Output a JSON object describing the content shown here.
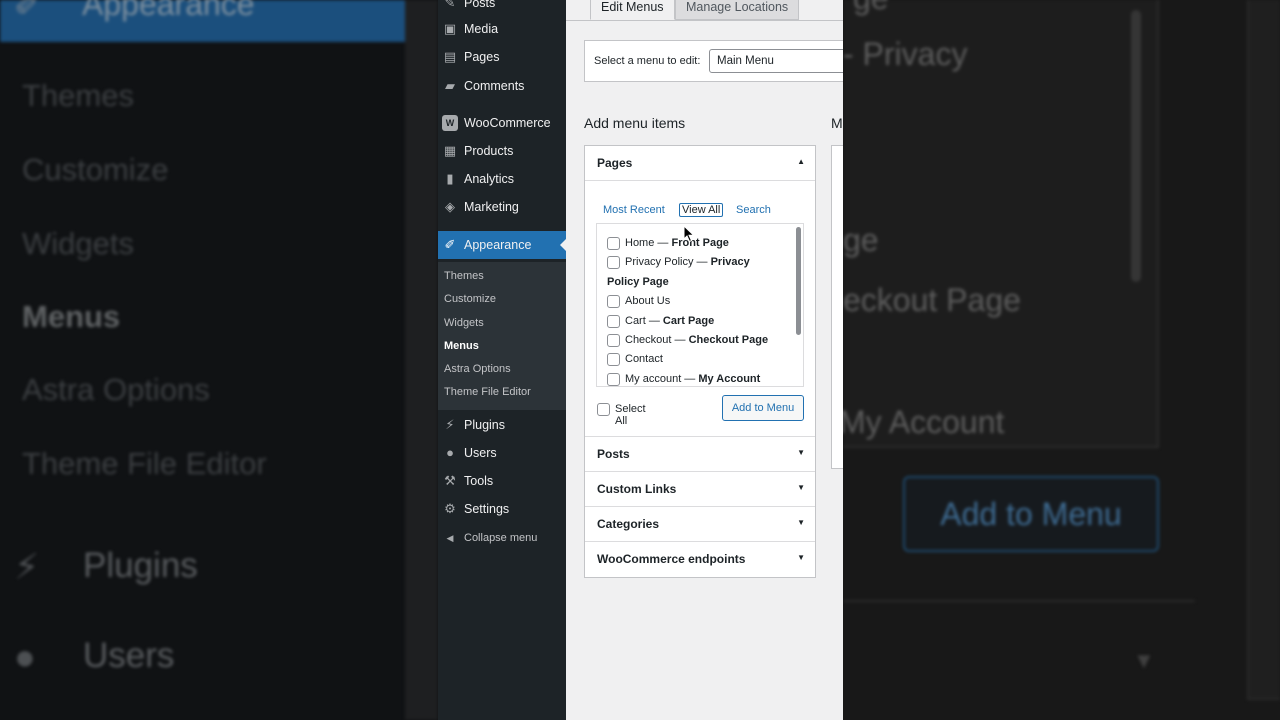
{
  "background_left": {
    "active": "Appearance",
    "items": [
      "Themes",
      "Customize",
      "Widgets",
      "Menus",
      "Astra Options",
      "Theme File Editor"
    ],
    "bottom_items": [
      "Plugins",
      "Users"
    ]
  },
  "background_right": {
    "texts": [
      "ge",
      "- Privacy",
      "ge",
      "eckout Page",
      "My Account"
    ],
    "button": "Add to Menu"
  },
  "sidebar": {
    "items": [
      {
        "label": "Posts",
        "icon": "posts-icon",
        "glyph": "✎"
      },
      {
        "label": "Media",
        "icon": "media-icon",
        "glyph": "▣"
      },
      {
        "label": "Pages",
        "icon": "pages-icon",
        "glyph": "▤"
      },
      {
        "label": "Comments",
        "icon": "comments-icon",
        "glyph": "▰"
      },
      {
        "label": "WooCommerce",
        "icon": "woocommerce-icon",
        "glyph": "W"
      },
      {
        "label": "Products",
        "icon": "products-icon",
        "glyph": "▦"
      },
      {
        "label": "Analytics",
        "icon": "analytics-icon",
        "glyph": "▮"
      },
      {
        "label": "Marketing",
        "icon": "marketing-icon",
        "glyph": "◈"
      },
      {
        "label": "Appearance",
        "icon": "appearance-icon",
        "glyph": "✐"
      },
      {
        "label": "Plugins",
        "icon": "plugins-icon",
        "glyph": "⚡"
      },
      {
        "label": "Users",
        "icon": "users-icon",
        "glyph": "●"
      },
      {
        "label": "Tools",
        "icon": "tools-icon",
        "glyph": "⚒"
      },
      {
        "label": "Settings",
        "icon": "settings-icon",
        "glyph": "⚙"
      }
    ],
    "submenu": [
      "Themes",
      "Customize",
      "Widgets",
      "Menus",
      "Astra Options",
      "Theme File Editor"
    ],
    "collapse_label": "Collapse menu",
    "collapse_glyph": "◀"
  },
  "tabs": {
    "edit": "Edit Menus",
    "manage": "Manage Locations"
  },
  "select_menu": {
    "label": "Select a menu to edit:",
    "value": "Main Menu"
  },
  "add_items": {
    "heading": "Add menu items",
    "right_heading": "M",
    "pages": {
      "title": "Pages",
      "tabs": [
        "Most Recent",
        "View All",
        "Search"
      ],
      "rows": [
        {
          "title": "Home",
          "sep": " — ",
          "label": "Front Page"
        },
        {
          "title": "Privacy Policy",
          "sep": " — ",
          "label": "Privacy"
        },
        {
          "title": "About Us",
          "sep": "",
          "label": ""
        },
        {
          "title": "Cart",
          "sep": " — ",
          "label": "Cart Page"
        },
        {
          "title": "Checkout",
          "sep": " — ",
          "label": "Checkout Page"
        },
        {
          "title": "Contact",
          "sep": "",
          "label": ""
        },
        {
          "title": "My account",
          "sep": " — ",
          "label": "My Account"
        }
      ],
      "wrap_text": "Policy Page",
      "select_all": "Select All",
      "add_button": "Add to Menu"
    },
    "sections": [
      "Posts",
      "Custom Links",
      "Categories",
      "WooCommerce endpoints"
    ]
  },
  "colors": {
    "accent": "#2271b1",
    "sidebar_bg": "#1d2327",
    "content_bg": "#f0f0f1"
  }
}
